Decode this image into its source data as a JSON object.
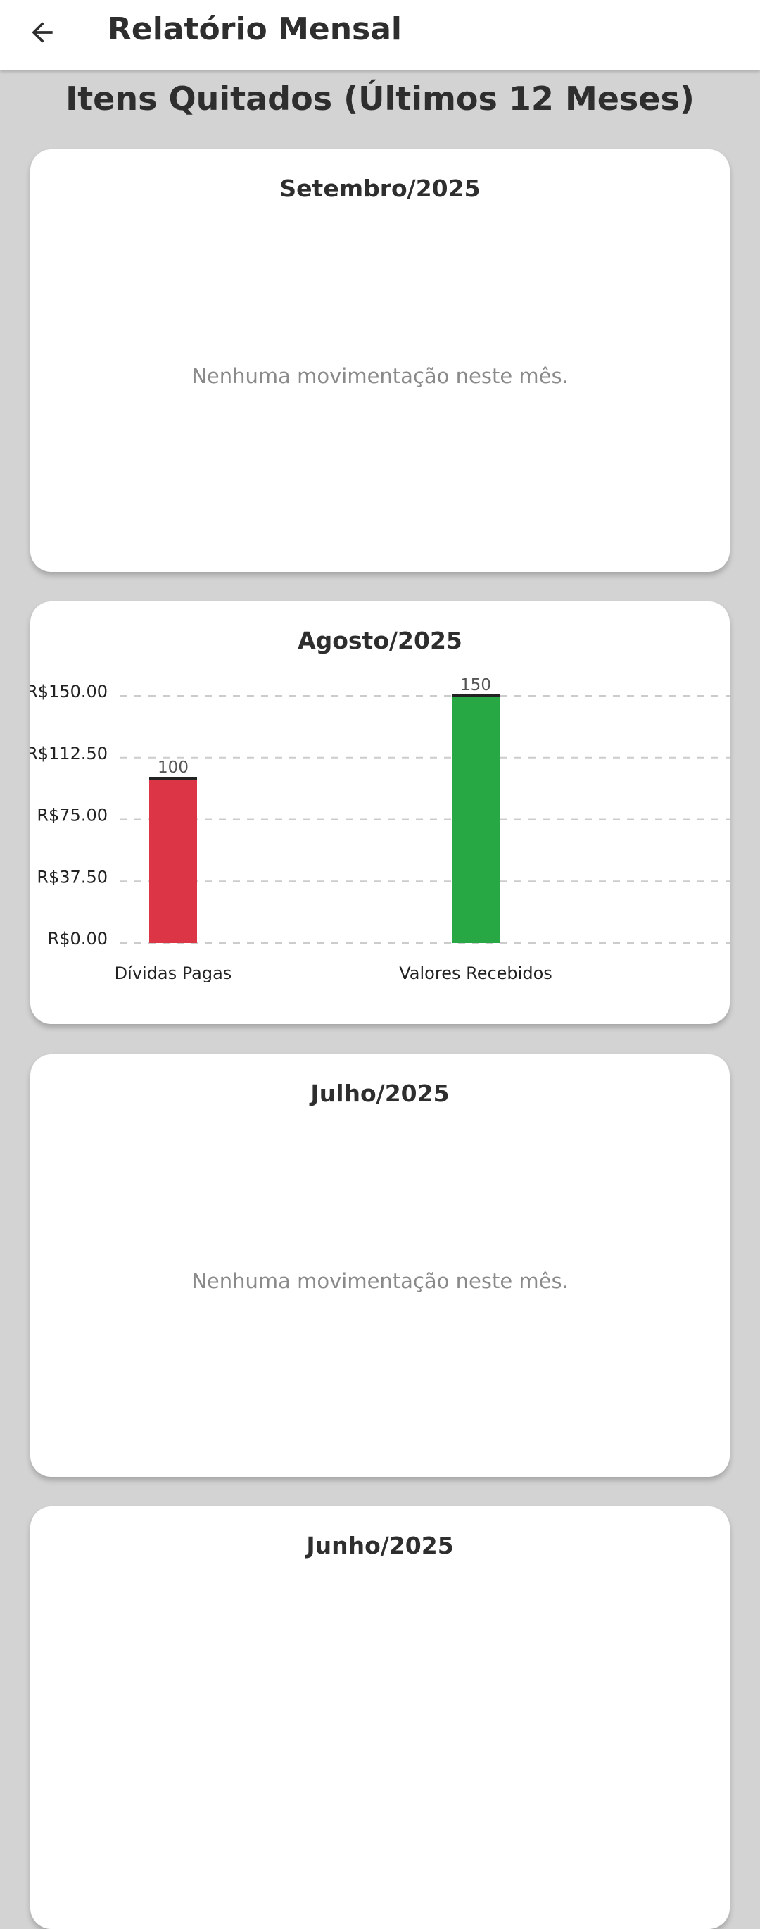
{
  "appbar": {
    "title": "Relatório Mensal",
    "back_icon": "arrow-left-icon"
  },
  "page": {
    "section_title": "Itens Quitados (Últimos 12 Meses)"
  },
  "months": [
    {
      "title": "Setembro/2025",
      "empty_message": "Nenhuma movimentação neste mês."
    },
    {
      "title": "Agosto/2025"
    },
    {
      "title": "Julho/2025",
      "empty_message": "Nenhuma movimentação neste mês."
    },
    {
      "title": "Junho/2025"
    }
  ],
  "colors": {
    "background": "#d3d3d3",
    "card": "#ffffff",
    "debts_paid": "#dc3545",
    "values_received": "#28a745"
  },
  "chart_data": {
    "type": "bar",
    "categories": [
      "Dívidas Pagas",
      "Valores Recebidos"
    ],
    "values": [
      100,
      150
    ],
    "data_labels": [
      "100",
      "150"
    ],
    "colors": [
      "#dc3545",
      "#28a745"
    ],
    "y_ticks": [
      "R$0.00",
      "R$37.50",
      "R$75.00",
      "R$112.50",
      "R$150.00"
    ],
    "ylim": [
      0,
      150
    ],
    "grid": true,
    "title": "Agosto/2025",
    "xlabel": "",
    "ylabel": ""
  }
}
